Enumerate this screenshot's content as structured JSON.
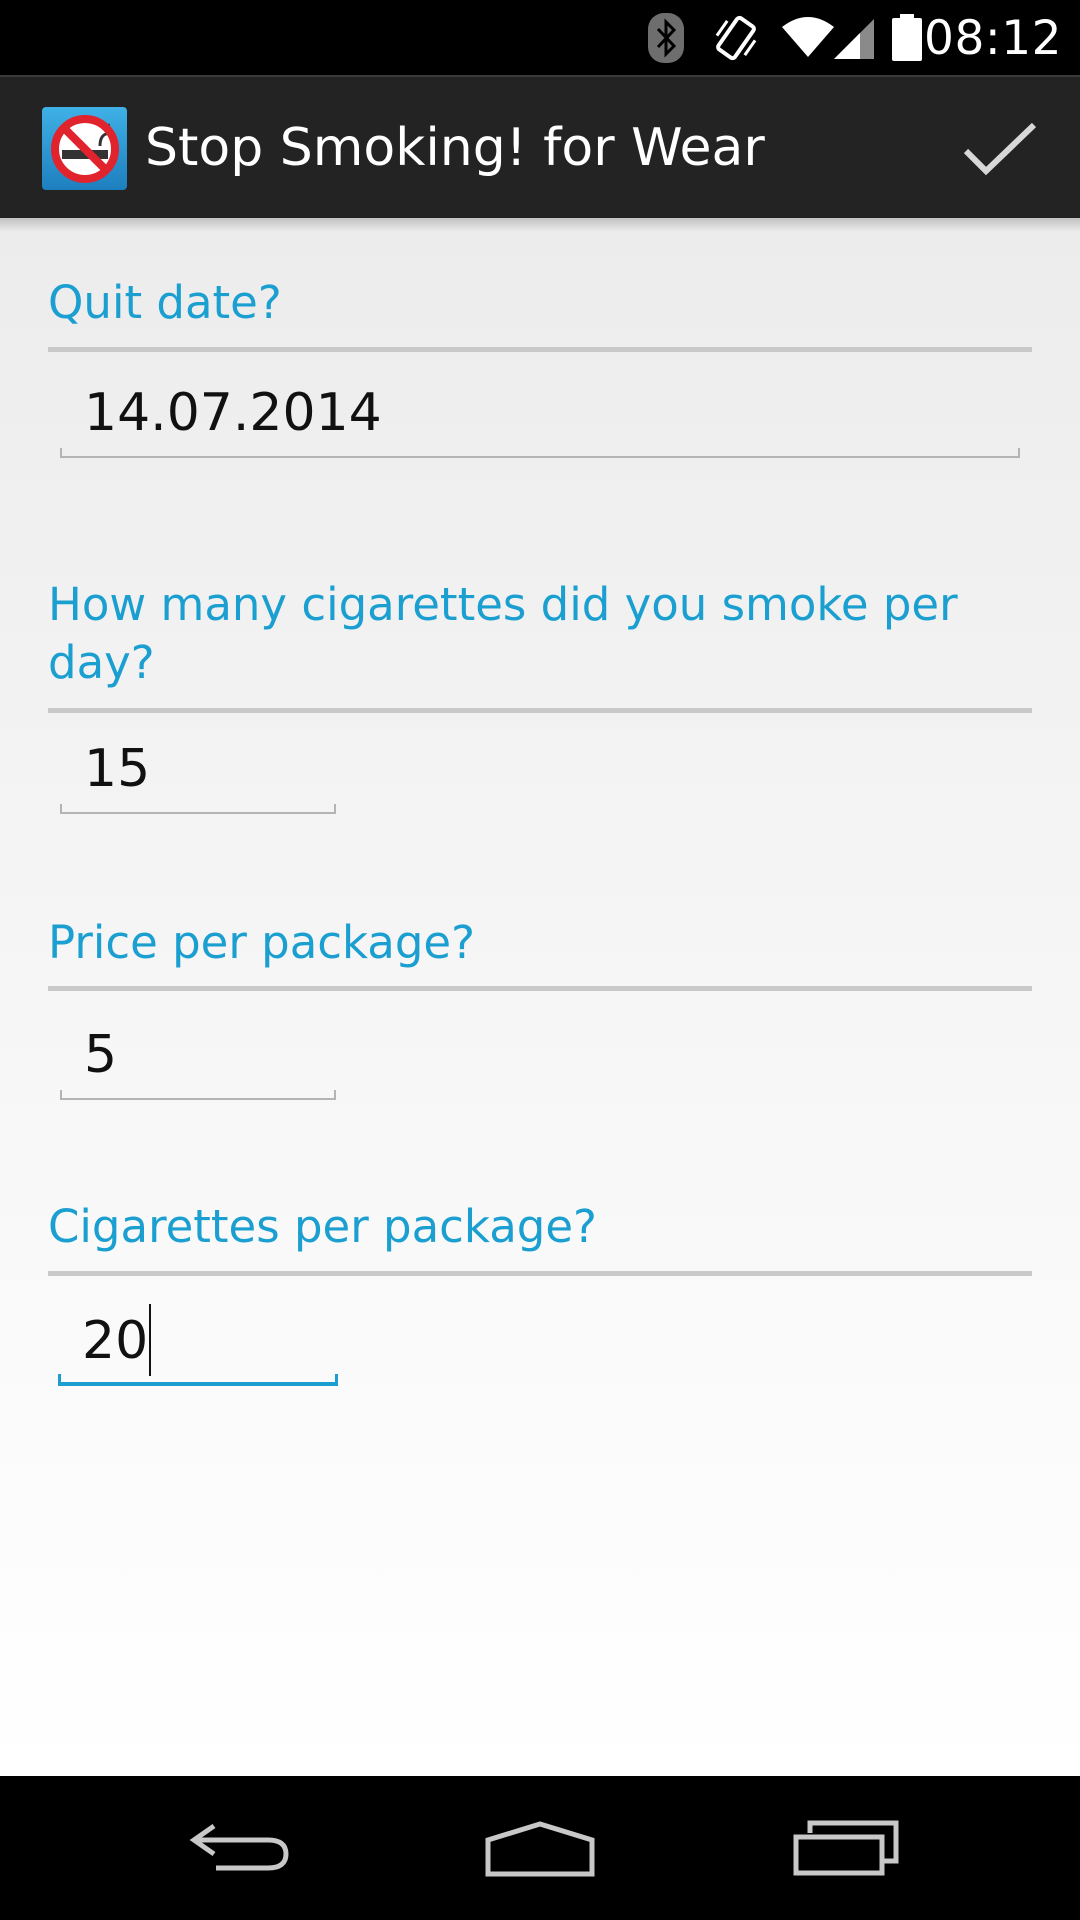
{
  "status_bar": {
    "time": "08:12",
    "icons": [
      "bluetooth-icon",
      "vibrate-icon",
      "wifi-icon",
      "signal-icon",
      "battery-icon"
    ]
  },
  "action_bar": {
    "app_icon": "no-smoking-icon",
    "title": "Stop Smoking! for Wear",
    "done_icon": "checkmark-icon"
  },
  "form": {
    "quit_date": {
      "label": "Quit date?",
      "value": "14.07.2014"
    },
    "cigs_per_day": {
      "label": "How many cigarettes did you smoke per day?",
      "value": "15"
    },
    "price_per_package": {
      "label": "Price per package?",
      "value": "5"
    },
    "cigs_per_package": {
      "label": "Cigarettes per package?",
      "value": "20"
    }
  },
  "nav_bar": {
    "icons": [
      "back-icon",
      "home-icon",
      "recent-apps-icon"
    ]
  },
  "colors": {
    "accent": "#1a9fd0",
    "action_bar": "#232323",
    "content_bg": "#f2f2f2"
  }
}
